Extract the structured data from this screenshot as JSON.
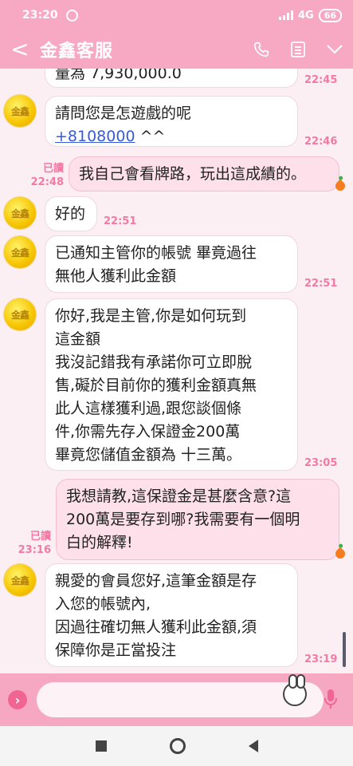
{
  "status": {
    "time": "23:20",
    "network": "4G",
    "battery": "66"
  },
  "header": {
    "back": "<",
    "title": "金鑫客服"
  },
  "avatar_text": "金鑫",
  "messages": [
    {
      "dir": "in",
      "text": "量為 7,930,000.0",
      "time": "22:45"
    },
    {
      "dir": "in",
      "text": "請問您是怎遊戲的呢",
      "link": "+8108000",
      "suffix": " ^^",
      "time": "22:46"
    },
    {
      "dir": "out",
      "read": "已讀",
      "time": "22:48",
      "text": "我自己會看牌路，玩出這成績的。"
    },
    {
      "dir": "in",
      "text": "好的",
      "time": "22:51"
    },
    {
      "dir": "in",
      "lines": [
        "已通知主管你的帳號 畢竟過往",
        "無他人獲利此金額"
      ],
      "time": "22:51"
    },
    {
      "dir": "in",
      "lines": [
        "你好,我是主管,你是如何玩到",
        "這金額",
        "我沒記錯我有承諾你可立即脫",
        "售,礙於目前你的獲利金額真無",
        "此人這樣獲利過,跟您談個條",
        "件,你需先存入保證金200萬",
        "畢竟您儲值金額為 十三萬。"
      ],
      "time": "23:05"
    },
    {
      "dir": "out",
      "read": "已讀",
      "time": "23:16",
      "lines": [
        "我想請教,這保證金是甚麼含意?這",
        "200萬是要存到哪?我需要有一個明",
        "白的解釋!"
      ]
    },
    {
      "dir": "in",
      "lines": [
        "親愛的會員您好,這筆金額是存",
        "入您的帳號內,",
        "因過往確切無人獲利此金額,須",
        "保障你是正當投注"
      ],
      "time": "23:19"
    }
  ],
  "input": {
    "placeholder": ""
  },
  "colors": {
    "accent": "#f7a9c4",
    "timestamp": "#f27aa3",
    "outgoing_bubble": "#fde0ea"
  }
}
